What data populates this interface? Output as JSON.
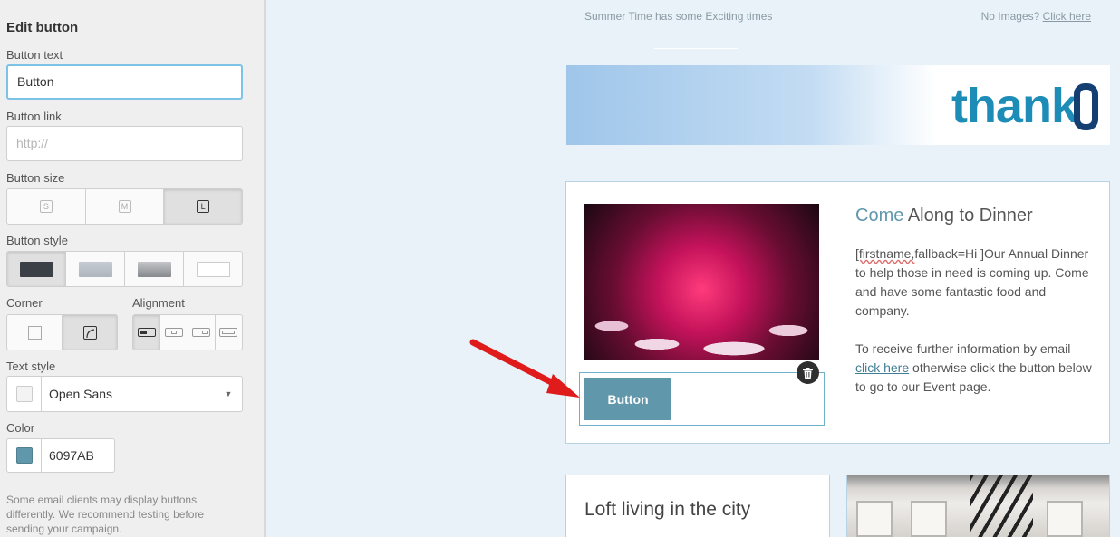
{
  "panel": {
    "title": "Edit button",
    "button_text_label": "Button text",
    "button_text_value": "Button",
    "button_link_label": "Button link",
    "button_link_placeholder": "http://",
    "button_size_label": "Button size",
    "sizes": [
      "S",
      "M",
      "L"
    ],
    "selected_size": "L",
    "button_style_label": "Button style",
    "styles": [
      {
        "color": "#3b4047"
      },
      {
        "color": "#b7bec6"
      },
      {
        "color": "#9a9da1"
      },
      {
        "color": "#ffffff"
      }
    ],
    "corner_label": "Corner",
    "alignment_label": "Alignment",
    "text_style_label": "Text style",
    "text_style_value": "Open Sans",
    "color_label": "Color",
    "color_value": "6097AB",
    "color_hex": "#6097AB",
    "note": "Some email clients may display buttons differently. We recommend testing before sending your campaign."
  },
  "email": {
    "preheader": "Summer Time has some Exciting times",
    "no_images_text": "No Images?",
    "no_images_link": "Click here",
    "logo_text": "thank",
    "card1": {
      "title_accent": "Come",
      "title_rest": " Along to Dinner",
      "para1_tag": "[firstname,",
      "para1_rest": "fallback=Hi ]Our Annual Dinner to help those in need is coming up. Come and have some fantastic food and company.",
      "para2_before": "To receive further information by email ",
      "para2_link": "click here",
      "para2_after": " otherwise click the button below to go to our Event page.",
      "button_label": "Button"
    },
    "card2": {
      "title": "Loft living in the city"
    }
  }
}
